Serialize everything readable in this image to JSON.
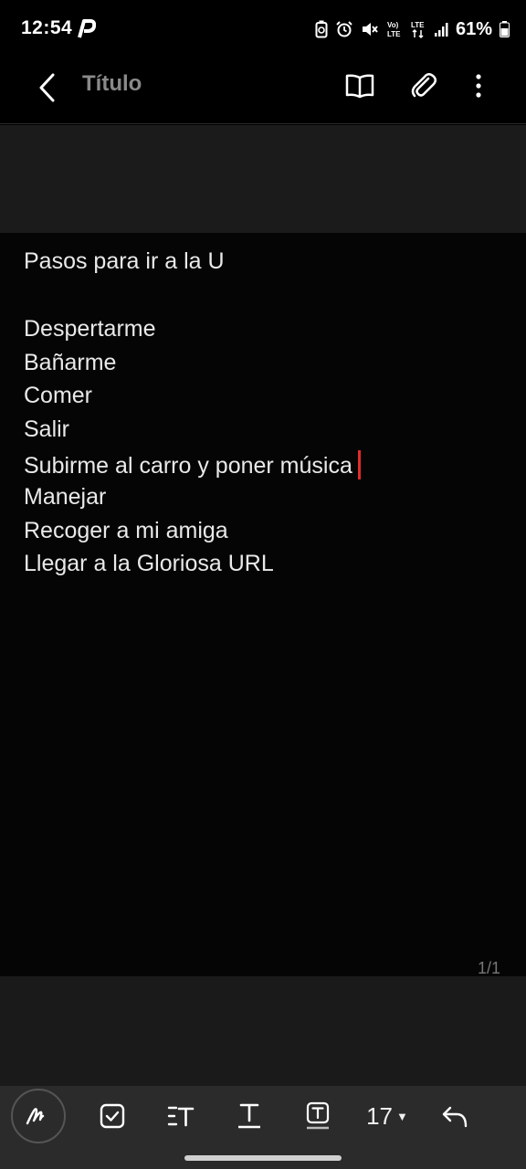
{
  "status": {
    "time": "12:54",
    "battery": "61%"
  },
  "app_bar": {
    "title": "Título"
  },
  "note": {
    "lines": [
      "Pasos para ir a la U",
      "",
      "Despertarme",
      "Bañarme",
      "Comer",
      "Salir",
      "Subirme al carro y poner música",
      "Manejar",
      "Recoger a mi amiga",
      "Llegar a la Gloriosa URL"
    ],
    "page_counter": "1/1"
  },
  "toolbar": {
    "font_size": "17"
  },
  "colors": {
    "cursor": "#e12c2c",
    "background": "#000000",
    "toolbar": "#2b2b2b"
  }
}
